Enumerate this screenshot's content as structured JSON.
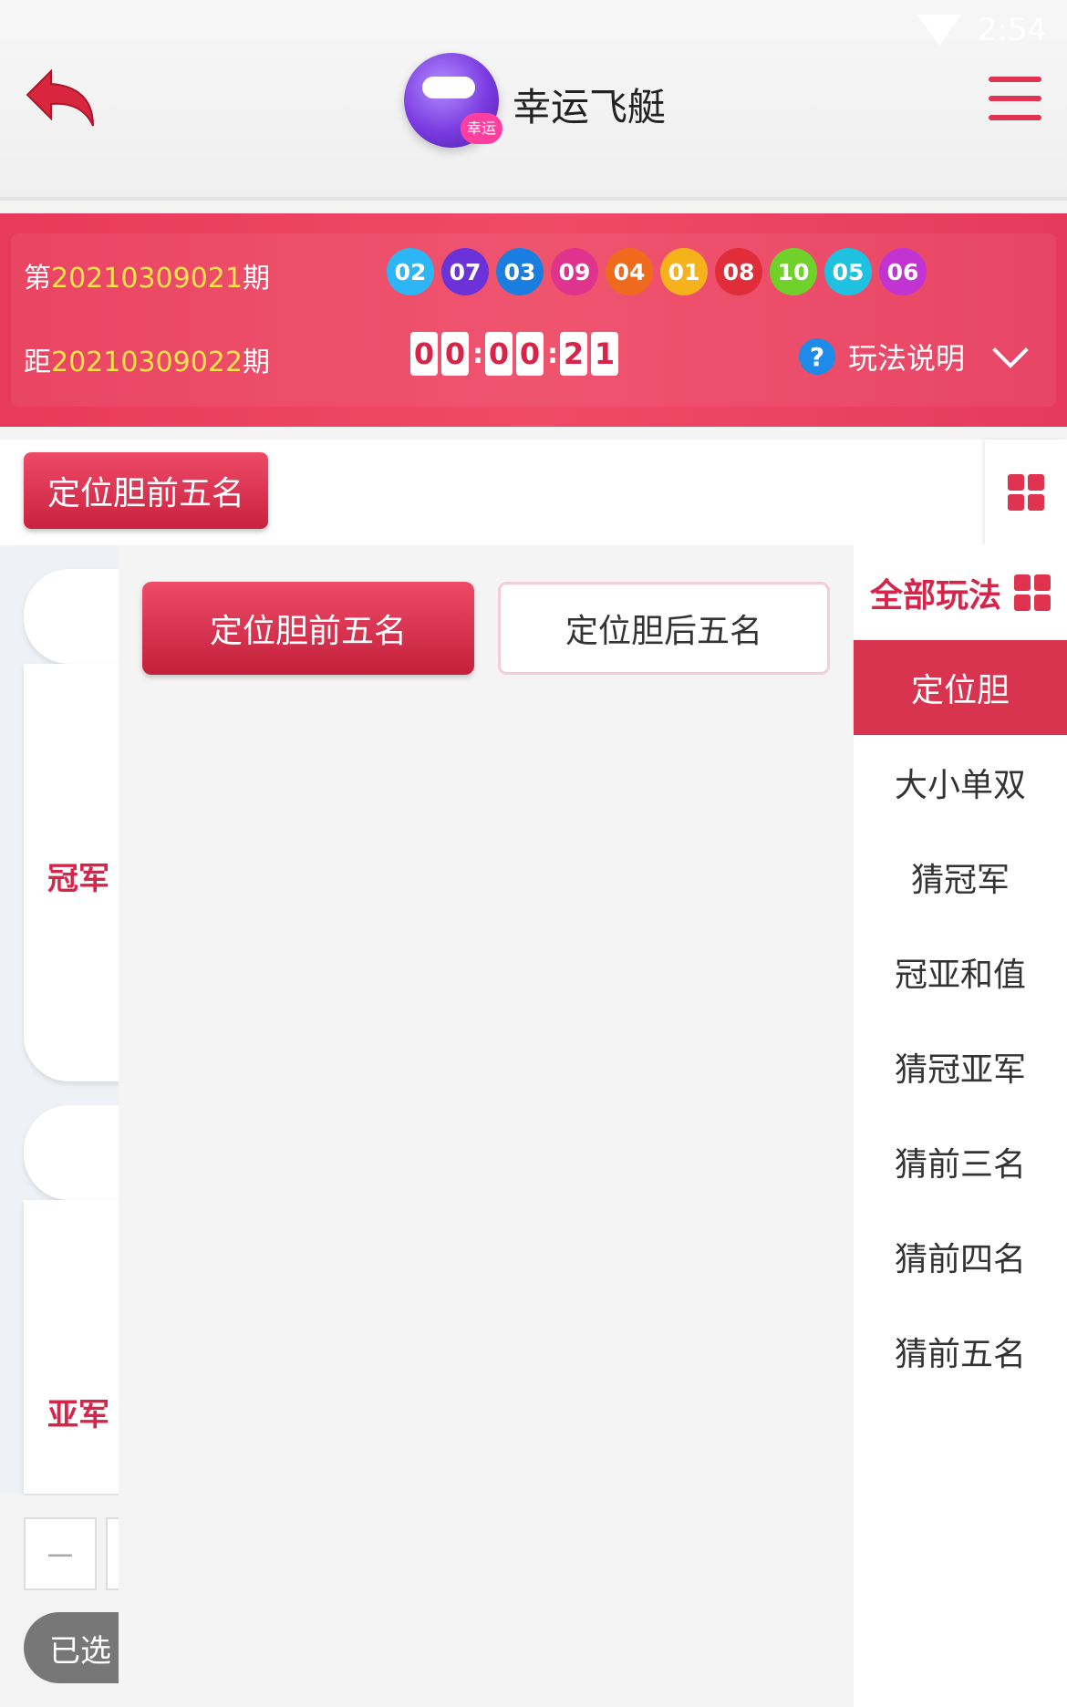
{
  "status": {
    "time": "2:54"
  },
  "header": {
    "title": "幸运飞艇",
    "logo_tag": "幸运"
  },
  "draw": {
    "current_prefix": "第",
    "current_issue": "20210309021",
    "current_suffix": "期",
    "next_prefix": "距",
    "next_issue": "20210309022",
    "next_suffix": "期",
    "balls": [
      {
        "num": "02",
        "color": "#2db6f5"
      },
      {
        "num": "07",
        "color": "#6a32d8"
      },
      {
        "num": "03",
        "color": "#1a7de0"
      },
      {
        "num": "09",
        "color": "#e0338e"
      },
      {
        "num": "04",
        "color": "#f06a1d"
      },
      {
        "num": "01",
        "color": "#f5b21a"
      },
      {
        "num": "08",
        "color": "#e12d3a"
      },
      {
        "num": "10",
        "color": "#6fd12a"
      },
      {
        "num": "05",
        "color": "#1ec2e0"
      },
      {
        "num": "06",
        "color": "#c234d2"
      }
    ],
    "timer": [
      "0",
      "0",
      "0",
      "0",
      "2",
      "1"
    ],
    "howto_label": "玩法说明",
    "howto_icon": "?"
  },
  "play_type": {
    "current": "定位胆前五名"
  },
  "bg": {
    "pos1": "冠军",
    "pos2": "亚军",
    "qty_minus": "－",
    "selected_label": "已选"
  },
  "overlay": {
    "options": [
      "定位胆前五名",
      "定位胆后五名"
    ]
  },
  "sidebar": {
    "title": "全部玩法",
    "items": [
      "定位胆",
      "大小单双",
      "猜冠军",
      "冠亚和值",
      "猜冠亚军",
      "猜前三名",
      "猜前四名",
      "猜前五名"
    ]
  },
  "colors": {
    "accent": "#d9344f",
    "highlight": "#ffe34a"
  }
}
